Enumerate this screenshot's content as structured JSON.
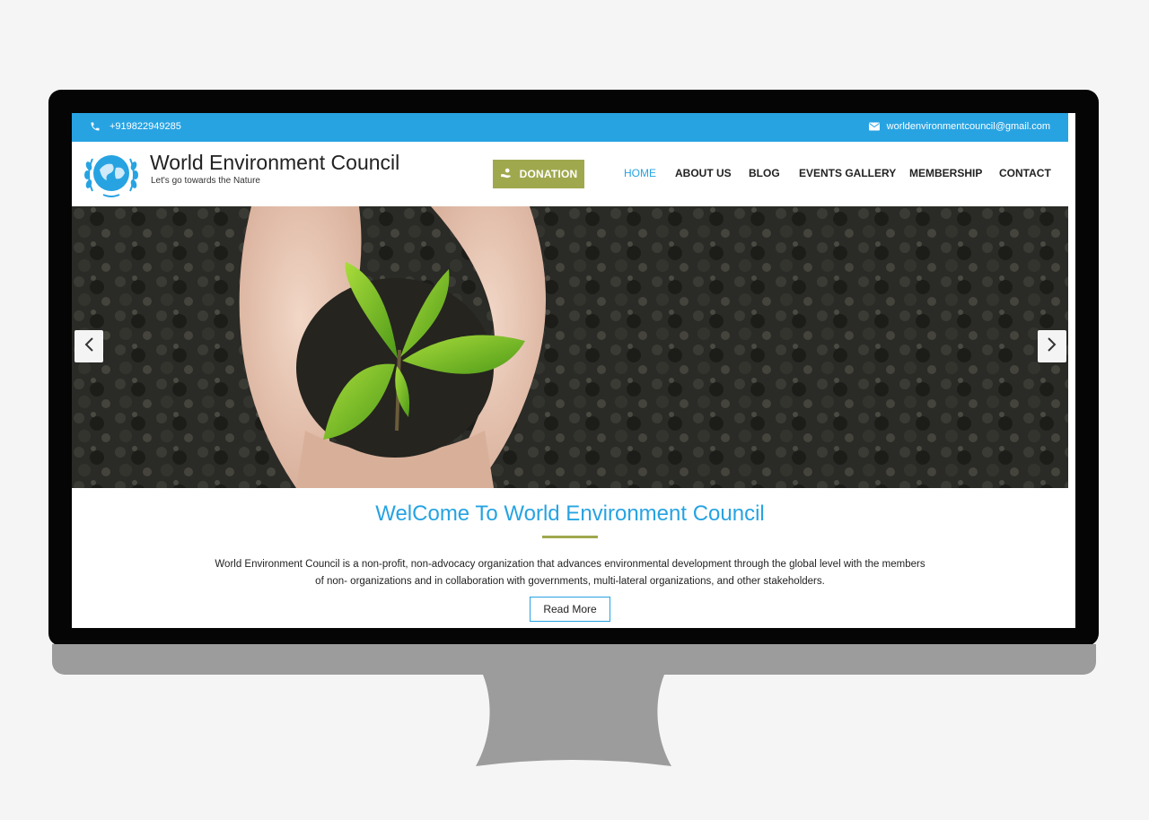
{
  "topbar": {
    "phone": "+919822949285",
    "email": "worldenvironmentcouncil@gmail.com",
    "phone_icon": "phone-icon",
    "email_icon": "envelope-icon"
  },
  "header": {
    "title": "World Environment Council",
    "tagline": "Let's go towards the Nature",
    "donation_label": "DONATION",
    "nav": [
      {
        "label": "HOME"
      },
      {
        "label": "ABOUT US"
      },
      {
        "label": "BLOG"
      },
      {
        "label": "EVENTS GALLERY"
      },
      {
        "label": "MEMBERSHIP"
      },
      {
        "label": "CONTACT"
      }
    ]
  },
  "hero": {
    "prev_icon": "chevron-left-icon",
    "next_icon": "chevron-right-icon"
  },
  "welcome": {
    "title": "WelCome To World Environment Council",
    "line1": "World Environment Council is a non-profit, non-advocacy organization that advances environmental development through the global level with the members",
    "line2": "of non- organizations and in collaboration with governments, multi-lateral organizations, and other stakeholders.",
    "read_more": "Read More"
  },
  "colors": {
    "accent_blue": "#27a3e2",
    "olive": "#a0a84e",
    "soil": "#2a2a26"
  }
}
